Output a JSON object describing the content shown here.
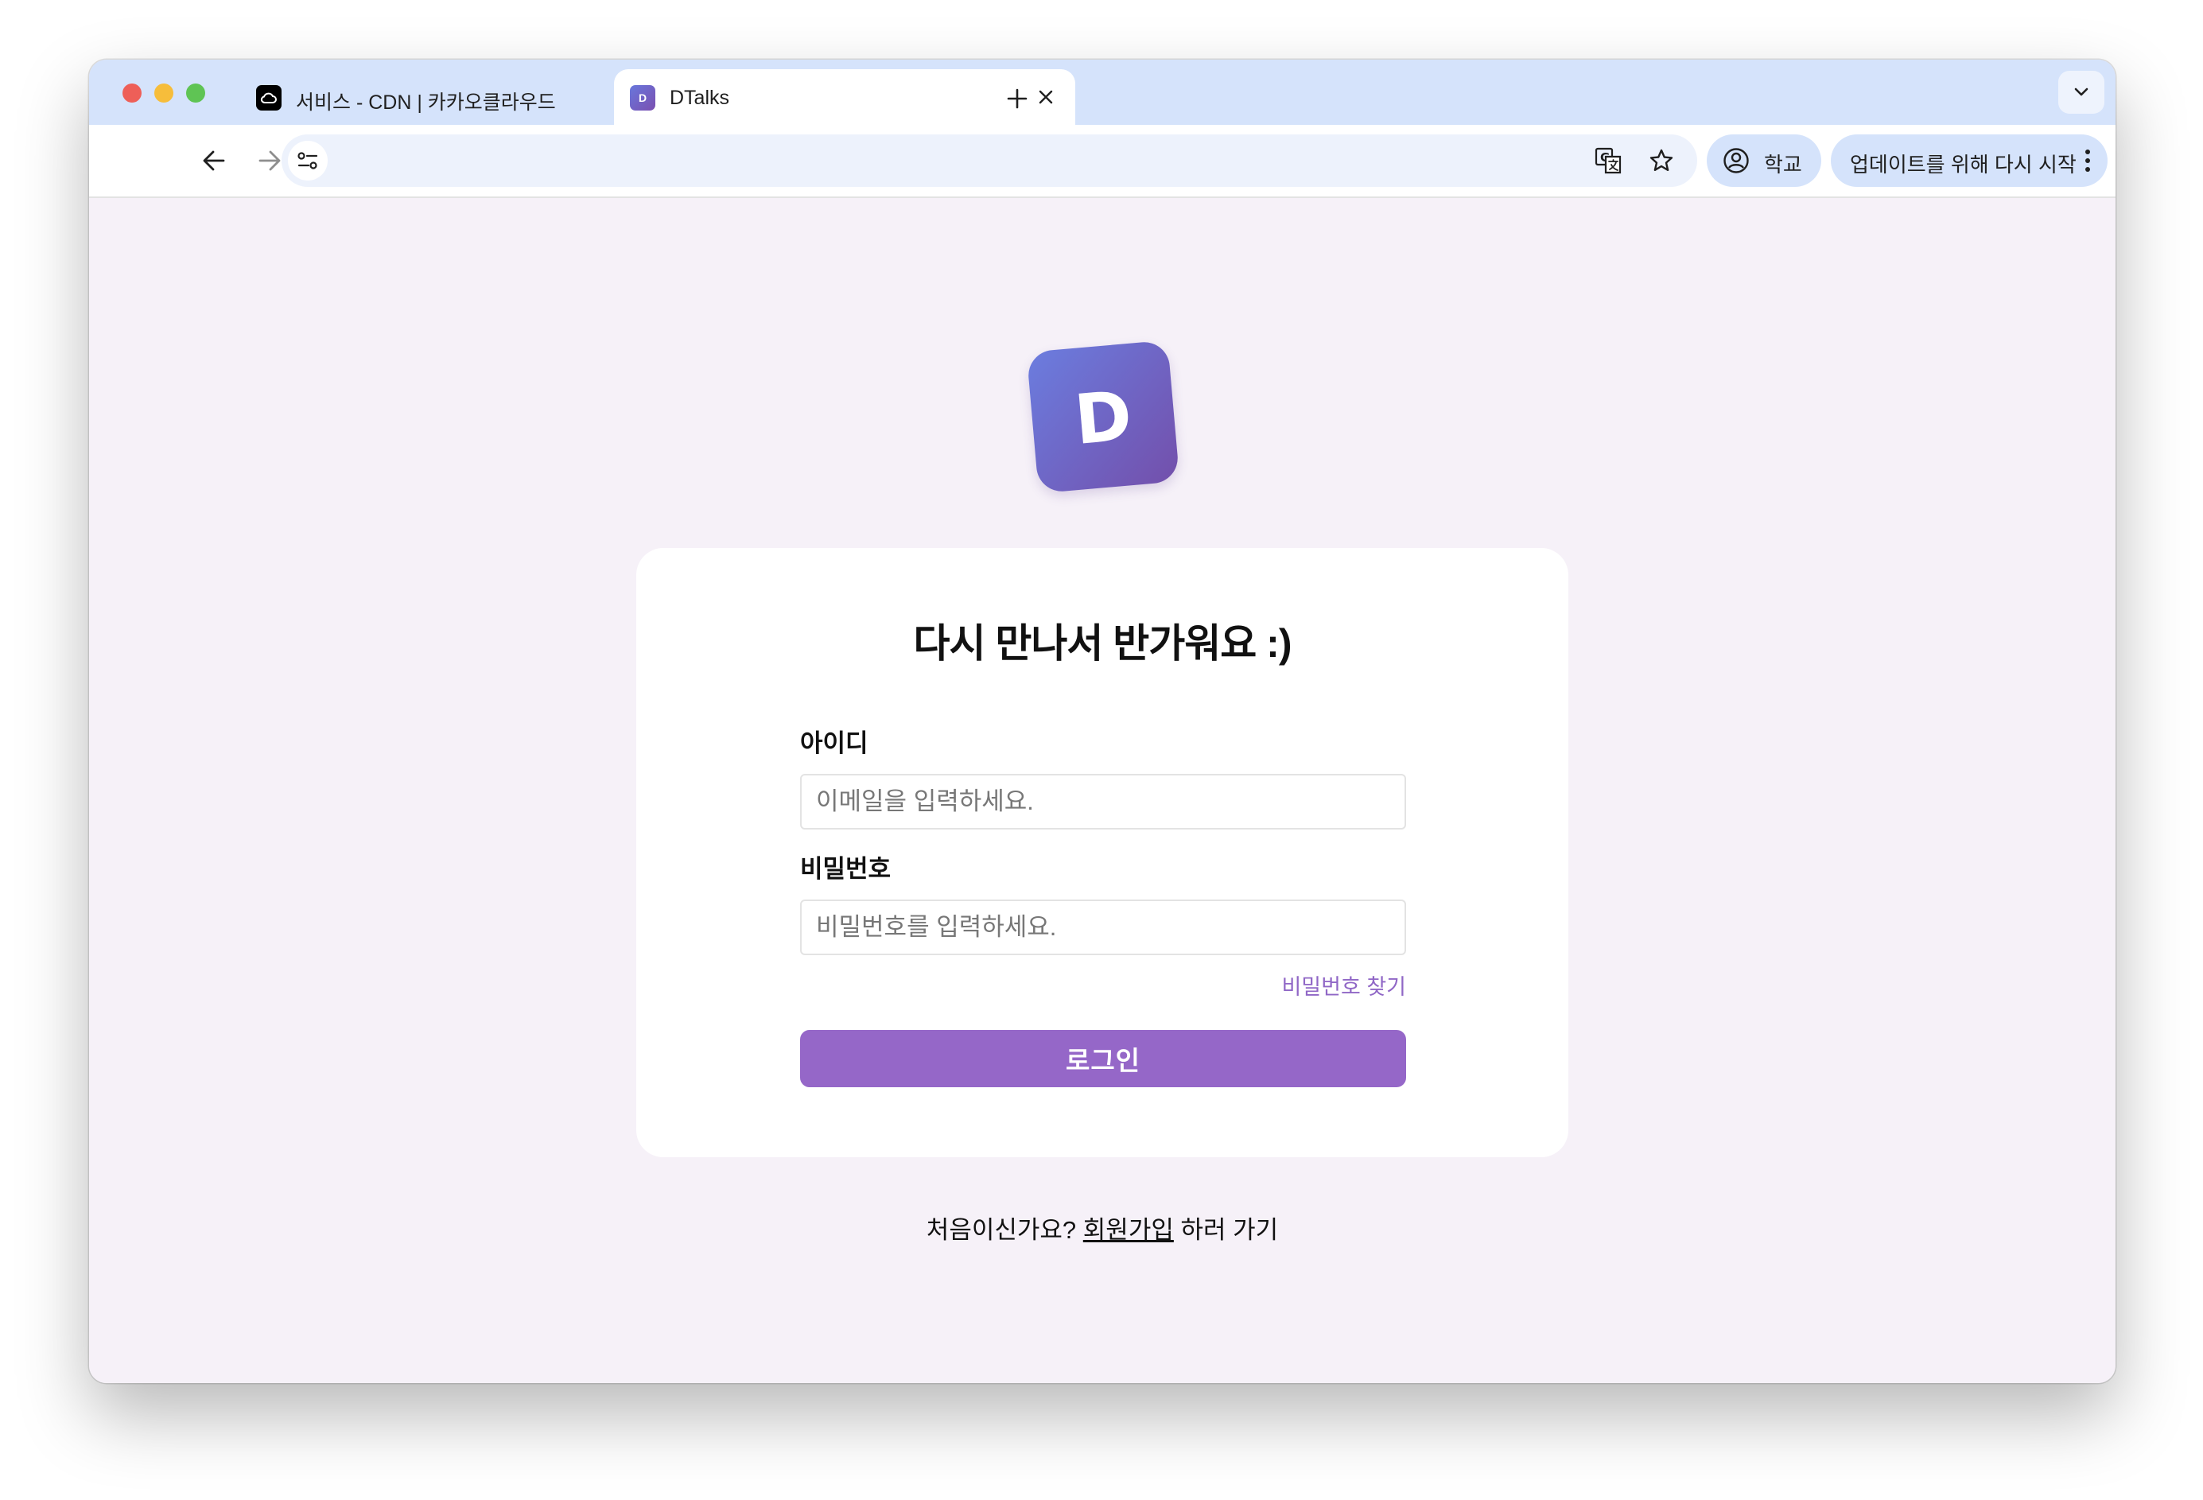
{
  "browser": {
    "tabs": [
      {
        "title": "서비스 - CDN | 카카오클라우드",
        "favicon": "cloud-icon"
      },
      {
        "title": "DTalks",
        "favicon": "D",
        "active": true
      }
    ],
    "profile_label": "학교",
    "update_label": "업데이트를 위해 다시 시작"
  },
  "page": {
    "logo_letter": "D",
    "title": "다시 만나서 반가워요 :)",
    "id_label": "아이디",
    "id_placeholder": "이메일을 입력하세요.",
    "pw_label": "비밀번호",
    "pw_placeholder": "비밀번호를 입력하세요.",
    "find_pw": "비밀번호 찾기",
    "login_button": "로그인",
    "signup_prefix": "처음이신가요? ",
    "signup_link": "회원가입",
    "signup_suffix": " 하러 가기"
  },
  "colors": {
    "accent": "#9567c8",
    "link": "#9067c6",
    "background": "#f6f1f8",
    "tabstrip": "#d5e3fb"
  }
}
